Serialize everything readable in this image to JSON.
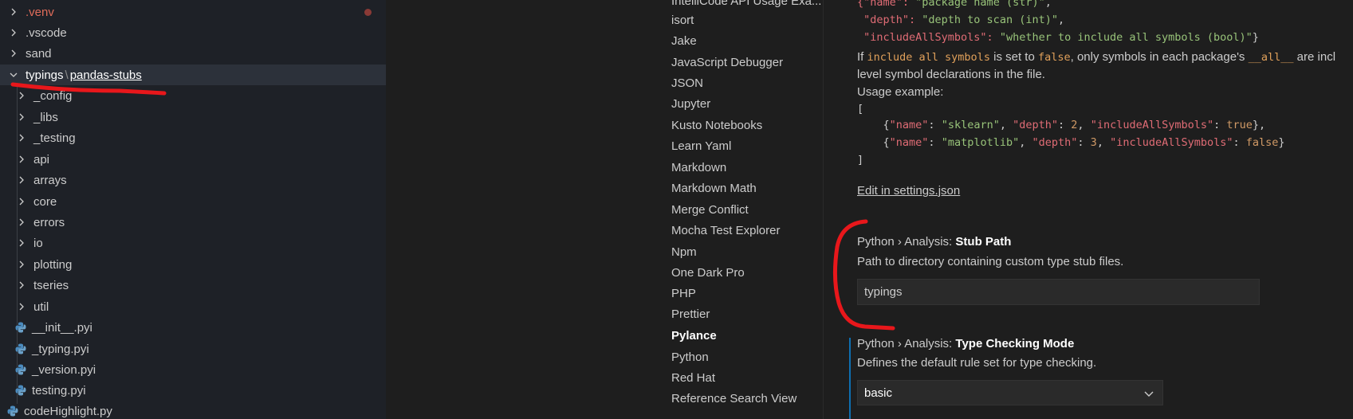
{
  "explorer": {
    "rows": [
      {
        "label": ".venv",
        "type": "folder"
      },
      {
        "label": ".vscode",
        "type": "folder"
      },
      {
        "label": "sand",
        "type": "folder"
      },
      {
        "label": "typings",
        "label2": "pandas-stubs",
        "type": "folder-open"
      },
      {
        "label": "_config",
        "type": "folder"
      },
      {
        "label": "_libs",
        "type": "folder"
      },
      {
        "label": "_testing",
        "type": "folder"
      },
      {
        "label": "api",
        "type": "folder"
      },
      {
        "label": "arrays",
        "type": "folder"
      },
      {
        "label": "core",
        "type": "folder"
      },
      {
        "label": "errors",
        "type": "folder"
      },
      {
        "label": "io",
        "type": "folder"
      },
      {
        "label": "plotting",
        "type": "folder"
      },
      {
        "label": "tseries",
        "type": "folder"
      },
      {
        "label": "util",
        "type": "folder"
      },
      {
        "label": "__init__.pyi",
        "type": "file"
      },
      {
        "label": "_typing.pyi",
        "type": "file"
      },
      {
        "label": "_version.pyi",
        "type": "file"
      },
      {
        "label": "testing.pyi",
        "type": "file"
      },
      {
        "label": "codeHighlight.py",
        "type": "file"
      }
    ]
  },
  "toc": {
    "items": [
      "IntelliCode API Usage Exa...",
      "isort",
      "Jake",
      "JavaScript Debugger",
      "JSON",
      "Jupyter",
      "Kusto Notebooks",
      "Learn Yaml",
      "Markdown",
      "Markdown Math",
      "Merge Conflict",
      "Mocha Test Explorer",
      "Npm",
      "One Dark Pro",
      "PHP",
      "Prettier",
      "Pylance",
      "Python",
      "Red Hat",
      "Reference Search View"
    ],
    "active": "Pylance"
  },
  "content": {
    "code_top": {
      "line1_a": "{\"name\": ",
      "line1_b": "\"package name (str)\"",
      "line1_c": ",",
      "line2_a": " \"depth\": ",
      "line2_b": "\"depth to scan (int)\"",
      "line2_c": ",",
      "line3_a": " \"includeAllSymbols\": ",
      "line3_b": "\"whether to include all symbols (bool)\"",
      "line3_c": "}"
    },
    "desc_prefix": "If ",
    "desc_code1": "include all symbols",
    "desc_mid1": " is set to ",
    "desc_code2": "false",
    "desc_mid2": ", only symbols in each package's ",
    "desc_code3": "__all__",
    "desc_suffix": " are incl",
    "desc_line2": "level symbol declarations in the file.",
    "usage_label": "Usage example:",
    "usage_open": "[",
    "usage_close": "]",
    "example1": {
      "name_key": "\"name\"",
      "name_val": "\"sklearn\"",
      "depth_key": "\"depth\"",
      "depth_val": "2",
      "ias_key": "\"includeAllSymbols\"",
      "ias_val": "true"
    },
    "example2": {
      "name_key": "\"name\"",
      "name_val": "\"matplotlib\"",
      "depth_key": "\"depth\"",
      "depth_val": "3",
      "ias_key": "\"includeAllSymbols\"",
      "ias_val": "false"
    },
    "edit_link": "Edit in settings.json",
    "stub_path": {
      "category": "Python › Analysis: ",
      "name": "Stub Path",
      "description": "Path to directory containing custom type stub files.",
      "value": "typings"
    },
    "type_checking": {
      "category": "Python › Analysis: ",
      "name": "Type Checking Mode",
      "description": "Defines the default rule set for type checking.",
      "value": "basic"
    }
  },
  "colors": {
    "annotation": "#e8171b",
    "accent": "#0e6fb1"
  }
}
